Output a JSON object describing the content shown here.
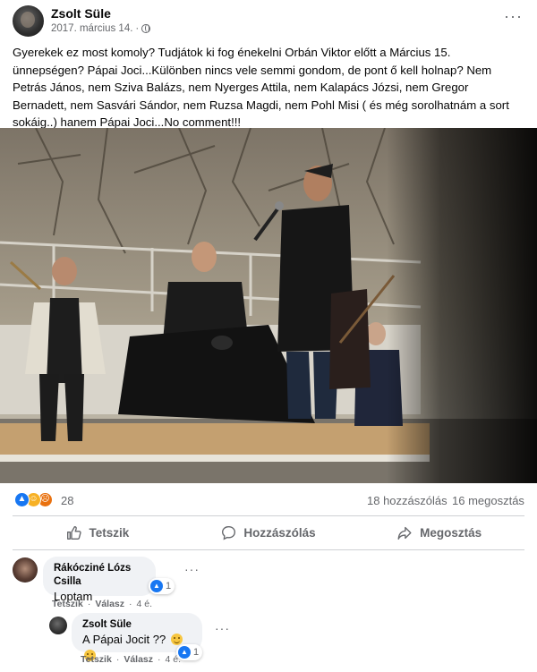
{
  "post": {
    "author": "Zsolt Süle",
    "date": "2017. március 14.",
    "more_glyph": "···",
    "text": "Gyerekek ez most komoly? Tudjátok ki fog énekelni Orbán Viktor előtt a Március 15. ünnepségen? Pápai Joci...Különben nincs vele semmi gondom, de pont ő kell holnap? Nem Petrás János, nem Sziva Balázs, nem Nyerges Attila, nem Kalapács Józsi, nem Gregor Bernadett, nem Sasvári Sándor, nem Ruzsa Magdi, nem  Pohl Misi ( és még sorolhatnám a sort sokáig..) hanem Pápai Joci...No comment!!!"
  },
  "reactions": {
    "count": "28",
    "comments": "18 hozzászólás",
    "shares": "16 megosztás",
    "colors": {
      "like": "#1877f2",
      "haha": "#f7b125",
      "angry": "#e9710f"
    }
  },
  "actions": {
    "like_label": "Tetszik",
    "comment_label": "Hozzászólás",
    "share_label": "Megosztás"
  },
  "comments": [
    {
      "author": "Rákócziné Lózs Csilla",
      "text": "Loptam",
      "reaction_count": "1",
      "like_link": "Tetszik",
      "reply_link": "Válasz",
      "age": "4 é."
    },
    {
      "author": "Zsolt Süle",
      "text": "A Pápai Jocit ??",
      "reaction_count": "1",
      "like_link": "Tetszik",
      "reply_link": "Válasz",
      "age": "4 é."
    }
  ],
  "theme": {
    "accent": "#1877f2",
    "secondary_text": "#65676b",
    "bubble_bg": "#f0f2f5"
  }
}
